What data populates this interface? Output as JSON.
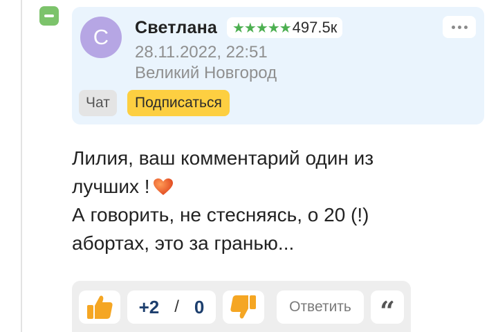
{
  "comment": {
    "collapse_icon": "minus-icon",
    "author": {
      "avatar_letter": "С",
      "name": "Светлана",
      "rating_stars": "★★★★★",
      "rating_count": "497.5к",
      "date": "28.11.2022, 22:51",
      "location": "Великий Новгород"
    },
    "buttons": {
      "chat": "Чат",
      "subscribe": "Подписаться"
    },
    "text_lines": [
      "Лилия, ваш комментарий один из",
      "лучших !",
      "А говорить, не стесняясь, о 20 (!)",
      "абортах, это за гранью..."
    ],
    "actions": {
      "score_plus": "+2",
      "score_separator": "/",
      "score_minus": "0",
      "reply": "Ответить",
      "quote_glyph": "“"
    },
    "colors": {
      "card_bg": "#eaf4fd",
      "avatar_bg": "#b6a6e4",
      "stars": "#4caf50",
      "subscribe_bg": "#fdcf41",
      "thumb": "#f5a623",
      "heart": "#e8562a",
      "collapse_bg": "#7cc36b"
    }
  }
}
